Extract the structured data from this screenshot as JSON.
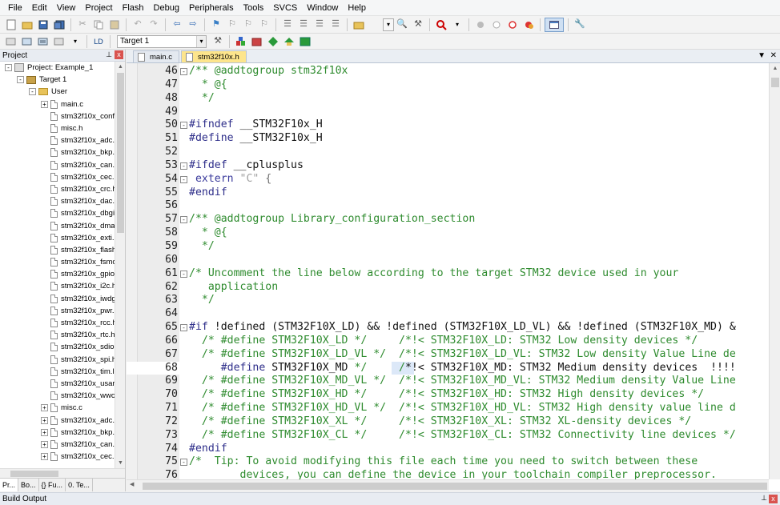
{
  "menu": [
    "File",
    "Edit",
    "View",
    "Project",
    "Flash",
    "Debug",
    "Peripherals",
    "Tools",
    "SVCS",
    "Window",
    "Help"
  ],
  "toolbar": {
    "target": "Target 1"
  },
  "project_panel": {
    "title": "Project",
    "close": "x",
    "tree": [
      {
        "label": "Project: Example_1",
        "indent": 0,
        "kind": "project",
        "exp": "-"
      },
      {
        "label": "Target 1",
        "indent": 1,
        "kind": "target",
        "exp": "-"
      },
      {
        "label": "User",
        "indent": 2,
        "kind": "folder",
        "exp": "-"
      },
      {
        "label": "main.c",
        "indent": 3,
        "kind": "file",
        "exp": "+"
      },
      {
        "label": "stm32f10x_conf",
        "indent": 3,
        "kind": "file",
        "exp": ""
      },
      {
        "label": "misc.h",
        "indent": 3,
        "kind": "file",
        "exp": ""
      },
      {
        "label": "stm32f10x_adc.",
        "indent": 3,
        "kind": "file",
        "exp": ""
      },
      {
        "label": "stm32f10x_bkp.",
        "indent": 3,
        "kind": "file",
        "exp": ""
      },
      {
        "label": "stm32f10x_can.",
        "indent": 3,
        "kind": "file",
        "exp": ""
      },
      {
        "label": "stm32f10x_cec.l",
        "indent": 3,
        "kind": "file",
        "exp": ""
      },
      {
        "label": "stm32f10x_crc.h",
        "indent": 3,
        "kind": "file",
        "exp": ""
      },
      {
        "label": "stm32f10x_dac.",
        "indent": 3,
        "kind": "file",
        "exp": ""
      },
      {
        "label": "stm32f10x_dbgi",
        "indent": 3,
        "kind": "file",
        "exp": ""
      },
      {
        "label": "stm32f10x_dma",
        "indent": 3,
        "kind": "file",
        "exp": ""
      },
      {
        "label": "stm32f10x_exti.l",
        "indent": 3,
        "kind": "file",
        "exp": ""
      },
      {
        "label": "stm32f10x_flash",
        "indent": 3,
        "kind": "file",
        "exp": ""
      },
      {
        "label": "stm32f10x_fsmc",
        "indent": 3,
        "kind": "file",
        "exp": ""
      },
      {
        "label": "stm32f10x_gpio",
        "indent": 3,
        "kind": "file",
        "exp": ""
      },
      {
        "label": "stm32f10x_i2c.h",
        "indent": 3,
        "kind": "file",
        "exp": ""
      },
      {
        "label": "stm32f10x_iwdg",
        "indent": 3,
        "kind": "file",
        "exp": ""
      },
      {
        "label": "stm32f10x_pwr.",
        "indent": 3,
        "kind": "file",
        "exp": ""
      },
      {
        "label": "stm32f10x_rcc.h",
        "indent": 3,
        "kind": "file",
        "exp": ""
      },
      {
        "label": "stm32f10x_rtc.h",
        "indent": 3,
        "kind": "file",
        "exp": ""
      },
      {
        "label": "stm32f10x_sdio",
        "indent": 3,
        "kind": "file",
        "exp": ""
      },
      {
        "label": "stm32f10x_spi.h",
        "indent": 3,
        "kind": "file",
        "exp": ""
      },
      {
        "label": "stm32f10x_tim.l",
        "indent": 3,
        "kind": "file",
        "exp": ""
      },
      {
        "label": "stm32f10x_usar",
        "indent": 3,
        "kind": "file",
        "exp": ""
      },
      {
        "label": "stm32f10x_wwc",
        "indent": 3,
        "kind": "file",
        "exp": ""
      },
      {
        "label": "misc.c",
        "indent": 3,
        "kind": "file",
        "exp": "+"
      },
      {
        "label": "stm32f10x_adc.",
        "indent": 3,
        "kind": "file",
        "exp": "+"
      },
      {
        "label": "stm32f10x_bkp.",
        "indent": 3,
        "kind": "file",
        "exp": "+"
      },
      {
        "label": "stm32f10x_can.",
        "indent": 3,
        "kind": "file",
        "exp": "+"
      },
      {
        "label": "stm32f10x_cec.",
        "indent": 3,
        "kind": "file",
        "exp": "+"
      }
    ],
    "tabs": [
      "Pr...",
      "Bo...",
      "{} Fu...",
      "0. Te..."
    ]
  },
  "editor": {
    "tabs": [
      {
        "label": "main.c",
        "active": false
      },
      {
        "label": "stm32f10x.h",
        "active": true
      }
    ],
    "lines": [
      {
        "n": "46",
        "fold": "-",
        "parts": [
          [
            "c-cm",
            "/** @addtogroup stm32f10x"
          ]
        ]
      },
      {
        "n": "47",
        "fold": "",
        "parts": [
          [
            "c-cm",
            "  * @{"
          ]
        ]
      },
      {
        "n": "48",
        "fold": "",
        "parts": [
          [
            "c-cm",
            "  */"
          ]
        ]
      },
      {
        "n": "49",
        "fold": "",
        "parts": []
      },
      {
        "n": "50",
        "fold": "-",
        "parts": [
          [
            "c-pp",
            "#ifndef"
          ],
          [
            "c-pl",
            " __STM32F10x_H"
          ]
        ]
      },
      {
        "n": "51",
        "fold": "",
        "parts": [
          [
            "c-pp",
            "#define"
          ],
          [
            "c-pl",
            " __STM32F10x_H"
          ]
        ]
      },
      {
        "n": "52",
        "fold": "",
        "parts": []
      },
      {
        "n": "53",
        "fold": "-",
        "parts": [
          [
            "c-pp",
            "#ifdef"
          ],
          [
            "c-pl",
            " __cplusplus"
          ]
        ]
      },
      {
        "n": "54",
        "fold": "-",
        "parts": [
          [
            "c-kw",
            " extern"
          ],
          [
            "c-pl",
            " "
          ],
          [
            "c-str",
            "\"C\""
          ],
          [
            "c-gr",
            " {"
          ]
        ]
      },
      {
        "n": "55",
        "fold": "",
        "parts": [
          [
            "c-pp",
            "#endif"
          ]
        ]
      },
      {
        "n": "56",
        "fold": "",
        "parts": []
      },
      {
        "n": "57",
        "fold": "-",
        "parts": [
          [
            "c-cm",
            "/** @addtogroup Library_configuration_section"
          ]
        ]
      },
      {
        "n": "58",
        "fold": "",
        "parts": [
          [
            "c-cm",
            "  * @{"
          ]
        ]
      },
      {
        "n": "59",
        "fold": "",
        "parts": [
          [
            "c-cm",
            "  */"
          ]
        ]
      },
      {
        "n": "60",
        "fold": "",
        "parts": []
      },
      {
        "n": "61",
        "fold": "-",
        "parts": [
          [
            "c-cm",
            "/* Uncomment the line below according to the target STM32 device used in your"
          ]
        ]
      },
      {
        "n": "62",
        "fold": "",
        "parts": [
          [
            "c-cm",
            "   application"
          ]
        ]
      },
      {
        "n": "63",
        "fold": "",
        "parts": [
          [
            "c-cm",
            "  */"
          ]
        ]
      },
      {
        "n": "64",
        "fold": "",
        "parts": []
      },
      {
        "n": "65",
        "fold": "-",
        "parts": [
          [
            "c-pp",
            "#if"
          ],
          [
            "c-pl",
            " !defined (STM32F10X_LD) && !defined (STM32F10X_LD_VL) && !defined (STM32F10X_MD) &"
          ]
        ]
      },
      {
        "n": "66",
        "fold": "",
        "parts": [
          [
            "c-cm",
            "  /* #define STM32F10X_LD */     /*!< STM32F10X_LD: STM32 Low density devices */"
          ]
        ]
      },
      {
        "n": "67",
        "fold": "",
        "parts": [
          [
            "c-cm",
            "  /* #define STM32F10X_LD_VL */  /*!< STM32F10X_LD_VL: STM32 Low density Value Line de"
          ]
        ]
      },
      {
        "n": "68",
        "fold": "",
        "cur": true,
        "parts": [
          [
            "c-pp",
            "     #define"
          ],
          [
            "c-pl",
            " STM32F10X_MD "
          ],
          [
            "c-cm",
            "*/"
          ],
          [
            "c-pl",
            "     "
          ],
          [
            "c-cm",
            "/"
          ],
          [
            "c-pl",
            "*!< STM32F10X_MD: STM32 Medium density devices  !!!!"
          ]
        ]
      },
      {
        "n": "69",
        "fold": "",
        "parts": [
          [
            "c-cm",
            "  /* #define STM32F10X_MD_VL */  /*!< STM32F10X_MD_VL: STM32 Medium density Value Line"
          ]
        ]
      },
      {
        "n": "70",
        "fold": "",
        "parts": [
          [
            "c-cm",
            "  /* #define STM32F10X_HD */     /*!< STM32F10X_HD: STM32 High density devices */"
          ]
        ]
      },
      {
        "n": "71",
        "fold": "",
        "parts": [
          [
            "c-cm",
            "  /* #define STM32F10X_HD_VL */  /*!< STM32F10X_HD_VL: STM32 High density value line d"
          ]
        ]
      },
      {
        "n": "72",
        "fold": "",
        "parts": [
          [
            "c-cm",
            "  /* #define STM32F10X_XL */     /*!< STM32F10X_XL: STM32 XL-density devices */"
          ]
        ]
      },
      {
        "n": "73",
        "fold": "",
        "parts": [
          [
            "c-cm",
            "  /* #define STM32F10X_CL */     /*!< STM32F10X_CL: STM32 Connectivity line devices */"
          ]
        ]
      },
      {
        "n": "74",
        "fold": "",
        "parts": [
          [
            "c-pp",
            "#endif"
          ]
        ]
      },
      {
        "n": "75",
        "fold": "-",
        "parts": [
          [
            "c-cm",
            "/*  Tip: To avoid modifying this file each time you need to switch between these"
          ]
        ]
      },
      {
        "n": "76",
        "fold": "",
        "parts": [
          [
            "c-cm",
            "        devices, you can define the device in your toolchain compiler preprocessor."
          ]
        ]
      }
    ]
  },
  "build_output": {
    "title": "Build Output",
    "close": "x"
  }
}
